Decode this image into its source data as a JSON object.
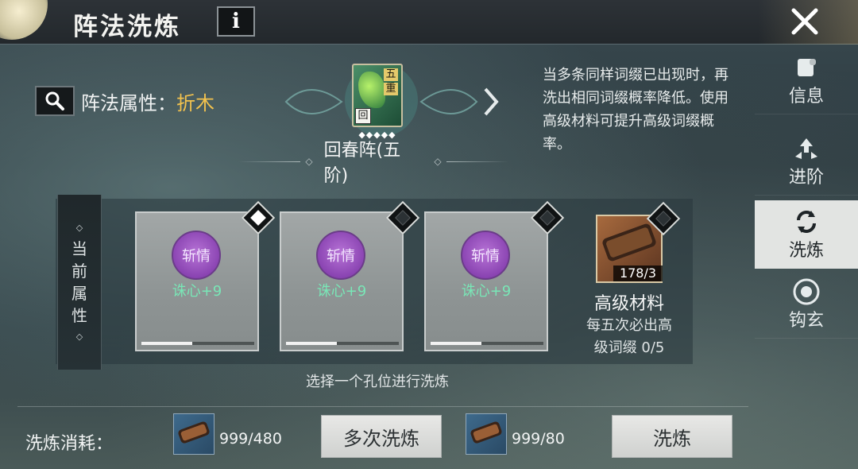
{
  "header": {
    "title": "阵法洗炼",
    "info_label": "i"
  },
  "side_tabs": [
    {
      "label": "信息",
      "icon": "scroll-icon",
      "active": false
    },
    {
      "label": "进阶",
      "icon": "arrows-up-icon",
      "active": false
    },
    {
      "label": "洗炼",
      "icon": "refresh-icon",
      "active": true
    },
    {
      "label": "钩玄",
      "icon": "bagua-icon",
      "active": false
    }
  ],
  "formation": {
    "attr_label": "阵法属性：",
    "attr_value": "折木",
    "icon_chars": [
      "五",
      "重"
    ],
    "icon_tag": "回",
    "stars": "◆◆◆◆◆",
    "name": "回春阵(五阶)"
  },
  "hint": "当多条同样词缀已出现时，再洗出相同词缀概率降低。使用高级材料可提升高级词缀概率。",
  "current_attr": {
    "chars": [
      "当",
      "前",
      "属",
      "性"
    ]
  },
  "slots": [
    {
      "badge": "斩情",
      "attr": "诛心+9",
      "progress": 0.45,
      "selected": true
    },
    {
      "badge": "斩情",
      "attr": "诛心+9",
      "progress": 0.45,
      "selected": false
    },
    {
      "badge": "斩情",
      "attr": "诛心+9",
      "progress": 0.45,
      "selected": false
    }
  ],
  "material": {
    "count": "178/3",
    "name": "高级材料",
    "desc_line1": "每五次必出高",
    "desc_line2": "级词缀 0/5"
  },
  "select_hint": "选择一个孔位进行洗炼",
  "bottom": {
    "cost_label": "洗炼消耗：",
    "multi_cost": "999/480",
    "multi_button": "多次洗炼",
    "single_cost": "999/80",
    "single_button": "洗炼"
  },
  "colors": {
    "accent_gold": "#f2c24e",
    "attr_green": "#79e7b7",
    "badge_purple": "#8a44b2"
  }
}
